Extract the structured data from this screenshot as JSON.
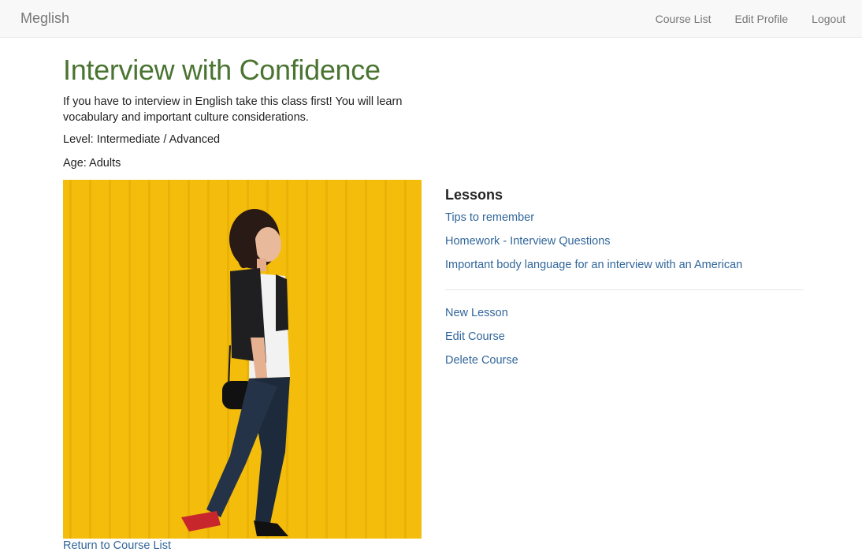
{
  "nav": {
    "brand": "Meglish",
    "links": [
      "Course List",
      "Edit Profile",
      "Logout"
    ]
  },
  "course": {
    "title": "Interview with Confidence",
    "description": "If you have to interview in English take this class first! You will learn vocabulary and important culture considerations.",
    "level": "Level: Intermediate / Advanced",
    "age": "Age: Adults"
  },
  "lessons": {
    "heading": "Lessons",
    "items": [
      "Tips to remember",
      "Homework - Interview Questions",
      "Important body language for an interview with an American"
    ]
  },
  "actions": [
    "New Lesson",
    "Edit Course",
    "Delete Course"
  ],
  "footer": {
    "return_label": "Return to Course List"
  },
  "colors": {
    "title": "#4a7431",
    "link": "#31669a",
    "image_background": "#f4bd0c"
  }
}
